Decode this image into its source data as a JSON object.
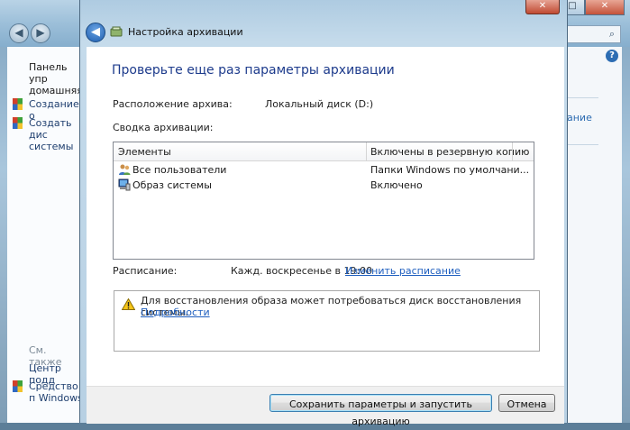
{
  "background_window": {
    "controls": {
      "minimize": "–",
      "maximize": "□",
      "close": "✕"
    },
    "search_icon": "search-icon",
    "help": "?",
    "left_panel": {
      "home_link": "Панель упр домашняя",
      "create1": "Создание о",
      "create2": "Создать дис системы",
      "see_also": "См. также",
      "center": "Центр подд",
      "tools": "Средство п Windows"
    },
    "right_link": "ание"
  },
  "dialog": {
    "close_label": "✕",
    "title": "Настройка архивации",
    "heading": "Проверьте еще раз параметры архивации",
    "location_label": "Расположение архива:",
    "location_value": "Локальный диск (D:)",
    "summary_label": "Сводка архивации:",
    "list": {
      "columns": [
        "Элементы",
        "Включены в резервную копию"
      ],
      "rows": [
        {
          "item": "Все пользователи",
          "value": "Папки Windows по умолчани...",
          "icon": "users-icon"
        },
        {
          "item": "Образ системы",
          "value": "Включено",
          "icon": "computer-icon"
        }
      ]
    },
    "schedule_label": "Расписание:",
    "schedule_value": "Кажд. воскресенье в 19:00",
    "schedule_link": "Изменить расписание",
    "info_text": "Для восстановления образа может потребоваться диск восстановления системы.",
    "info_link": "Подробности",
    "buttons": {
      "save": "Сохранить параметры и запустить архивацию",
      "cancel": "Отмена"
    }
  }
}
